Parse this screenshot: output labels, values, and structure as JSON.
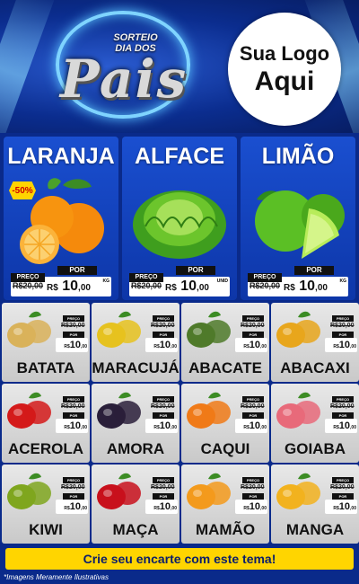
{
  "header": {
    "promo_top": "SORTEIO\nDIA DOS",
    "promo_main": "Pais",
    "logo_line1": "Sua Logo",
    "logo_line2": "Aqui"
  },
  "labels": {
    "preco": "PREÇO",
    "por": "POR",
    "currency": "R$"
  },
  "featured": [
    {
      "name": "LARANJA",
      "badge": "-50%",
      "old_price": "R$20,00",
      "price_int": "10",
      "price_dec": ",00",
      "unit": "KG",
      "icon": "orange-icon"
    },
    {
      "name": "ALFACE",
      "old_price": "R$20,00",
      "price_int": "10",
      "price_dec": ",00",
      "unit": "UNID",
      "icon": "lettuce-icon"
    },
    {
      "name": "LIMÃO",
      "old_price": "R$20,00",
      "price_int": "10",
      "price_dec": ",00",
      "unit": "KG",
      "icon": "lime-icon"
    }
  ],
  "products": [
    {
      "name": "BATATA",
      "old_price": "20,00",
      "price_int": "10",
      "price_dec": ",00",
      "unit": "KG",
      "icon": "potato-icon",
      "color": "#d9b25a"
    },
    {
      "name": "MARACUJÁ",
      "old_price": "20,00",
      "price_int": "10",
      "price_dec": ",00",
      "unit": "KG",
      "icon": "passion-fruit-icon",
      "color": "#e6c21f"
    },
    {
      "name": "ABACATE",
      "old_price": "20,00",
      "price_int": "10",
      "price_dec": ",00",
      "unit": "KG",
      "icon": "avocado-icon",
      "color": "#4f7a2a"
    },
    {
      "name": "ABACAXI",
      "old_price": "20,00",
      "price_int": "10",
      "price_dec": ",00",
      "unit": "KG",
      "icon": "pineapple-icon",
      "color": "#e8a61c"
    },
    {
      "name": "ACEROLA",
      "old_price": "20,00",
      "price_int": "10",
      "price_dec": ",00",
      "unit": "KG",
      "icon": "acerola-icon",
      "color": "#d41a1a"
    },
    {
      "name": "AMORA",
      "old_price": "20,00",
      "price_int": "10",
      "price_dec": ",00",
      "unit": "KG",
      "icon": "blackberry-icon",
      "color": "#2a1f3a"
    },
    {
      "name": "CAQUI",
      "old_price": "20,00",
      "price_int": "10",
      "price_dec": ",00",
      "unit": "KG",
      "icon": "persimmon-icon",
      "color": "#f07a18"
    },
    {
      "name": "GOIABA",
      "old_price": "20,00",
      "price_int": "10",
      "price_dec": ",00",
      "unit": "KG",
      "icon": "guava-icon",
      "color": "#e86a7a"
    },
    {
      "name": "KIWI",
      "old_price": "20,00",
      "price_int": "10",
      "price_dec": ",00",
      "unit": "KG",
      "icon": "kiwi-icon",
      "color": "#7fa61e"
    },
    {
      "name": "MAÇA",
      "old_price": "20,00",
      "price_int": "10",
      "price_dec": ",00",
      "unit": "KG",
      "icon": "apple-icon",
      "color": "#c8101c"
    },
    {
      "name": "MAMÃO",
      "old_price": "20,00",
      "price_int": "10",
      "price_dec": ",00",
      "unit": "KG",
      "icon": "papaya-icon",
      "color": "#f39a1c"
    },
    {
      "name": "MANGA",
      "old_price": "20,00",
      "price_int": "10",
      "price_dec": ",00",
      "unit": "KG",
      "icon": "mango-icon",
      "color": "#f2b21e"
    }
  ],
  "cta": "Crie seu encarte com este tema!",
  "footnote": "*Imagens Meramente Ilustrativas"
}
